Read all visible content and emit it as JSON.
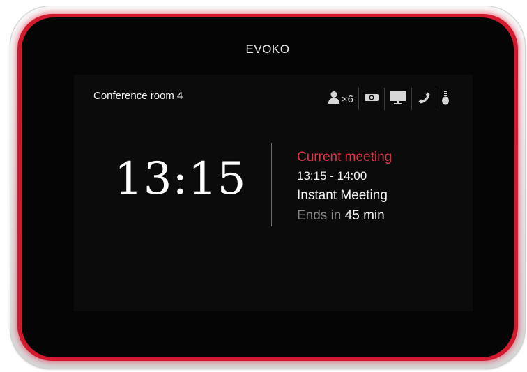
{
  "device": {
    "brand": "EVOKO"
  },
  "room": {
    "name": "Conference room 4"
  },
  "status_icons": {
    "capacity": "×6",
    "items": [
      "person-icon",
      "projector-icon",
      "monitor-icon",
      "phone-icon",
      "light-icon"
    ]
  },
  "clock": {
    "time": "13:15"
  },
  "meeting": {
    "label": "Current meeting",
    "time_range": "13:15 - 14:00",
    "title": "Instant Meeting",
    "ends_prefix": "Ends in",
    "ends_value": "45 min"
  },
  "colors": {
    "accent_red": "#e0334a",
    "frame_glow": "#d21a2f",
    "screen_bg": "#0b0b0b"
  }
}
